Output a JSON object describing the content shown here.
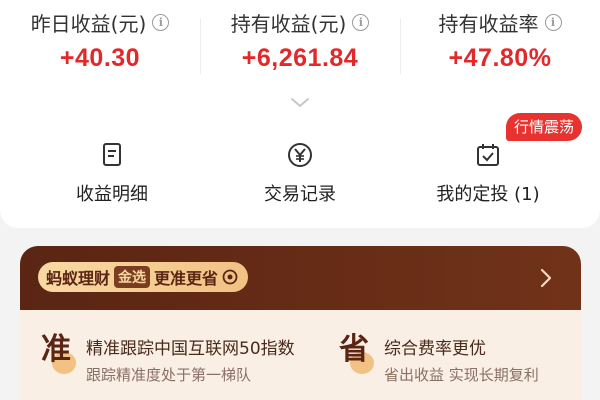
{
  "stats": [
    {
      "label": "昨日收益(元)",
      "value": "+40.30"
    },
    {
      "label": "持有收益(元)",
      "value": "+6,261.84"
    },
    {
      "label": "持有收益率",
      "value": "+47.80%"
    }
  ],
  "info_glyph": "i",
  "actions": [
    {
      "label": "收益明细",
      "icon": "document-icon"
    },
    {
      "label": "交易记录",
      "icon": "yen-icon"
    },
    {
      "label": "我的定投 (1)",
      "icon": "calendar-icon"
    }
  ],
  "hot_badge": "行情震荡",
  "promo": {
    "brand": "蚂蚁理财",
    "tag": "金选",
    "slogan": "更准更省",
    "features": [
      {
        "glyph": "准",
        "title": "精准跟踪中国互联网50指数",
        "subtitle": "跟踪精准度处于第一梯队"
      },
      {
        "glyph": "省",
        "title": "综合费率更优",
        "subtitle": "省出收益 实现长期复利"
      }
    ]
  },
  "colors": {
    "gain": "#e3282a",
    "badge": "#e8322f",
    "promo_dark": "#5a2513",
    "promo_light": "#f9efe5"
  }
}
